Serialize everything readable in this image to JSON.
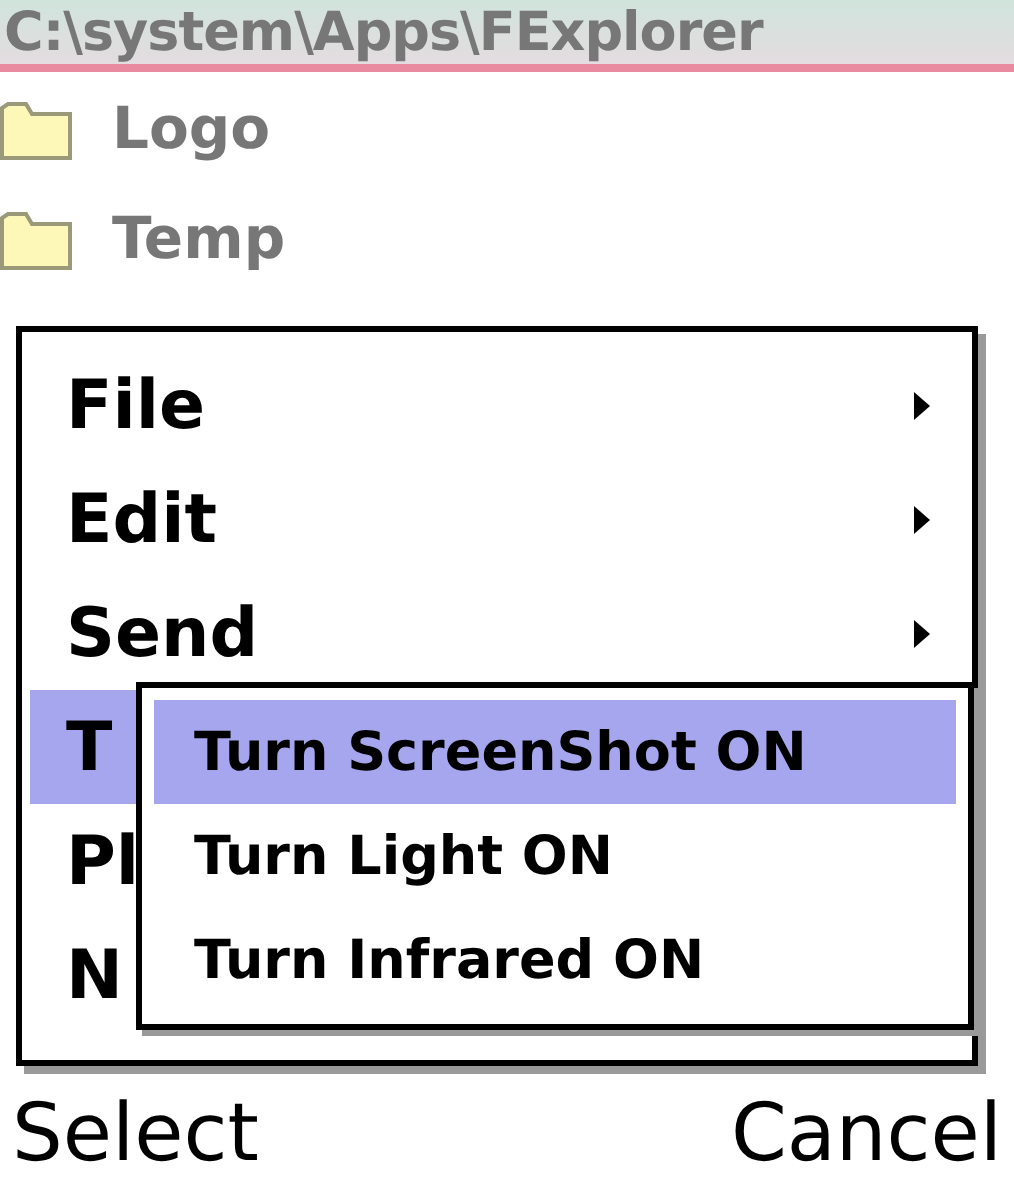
{
  "title_bar": {
    "path": "C:\\system\\Apps\\FExplorer"
  },
  "folders": [
    {
      "name": "Logo"
    },
    {
      "name": "Temp"
    }
  ],
  "menu": {
    "items": [
      {
        "label": "File",
        "has_submenu": true,
        "selected": false
      },
      {
        "label": "Edit",
        "has_submenu": true,
        "selected": false
      },
      {
        "label": "Send",
        "has_submenu": true,
        "selected": false
      },
      {
        "label": "T",
        "selected": true
      },
      {
        "label": "Pl",
        "selected": false
      },
      {
        "label": "N",
        "selected": false
      }
    ]
  },
  "submenu": {
    "items": [
      {
        "label": "Turn ScreenShot ON",
        "selected": true
      },
      {
        "label": "Turn Light ON",
        "selected": false
      },
      {
        "label": "Turn Infrared ON",
        "selected": false
      }
    ]
  },
  "softkeys": {
    "left": "Select",
    "right": "Cancel"
  }
}
